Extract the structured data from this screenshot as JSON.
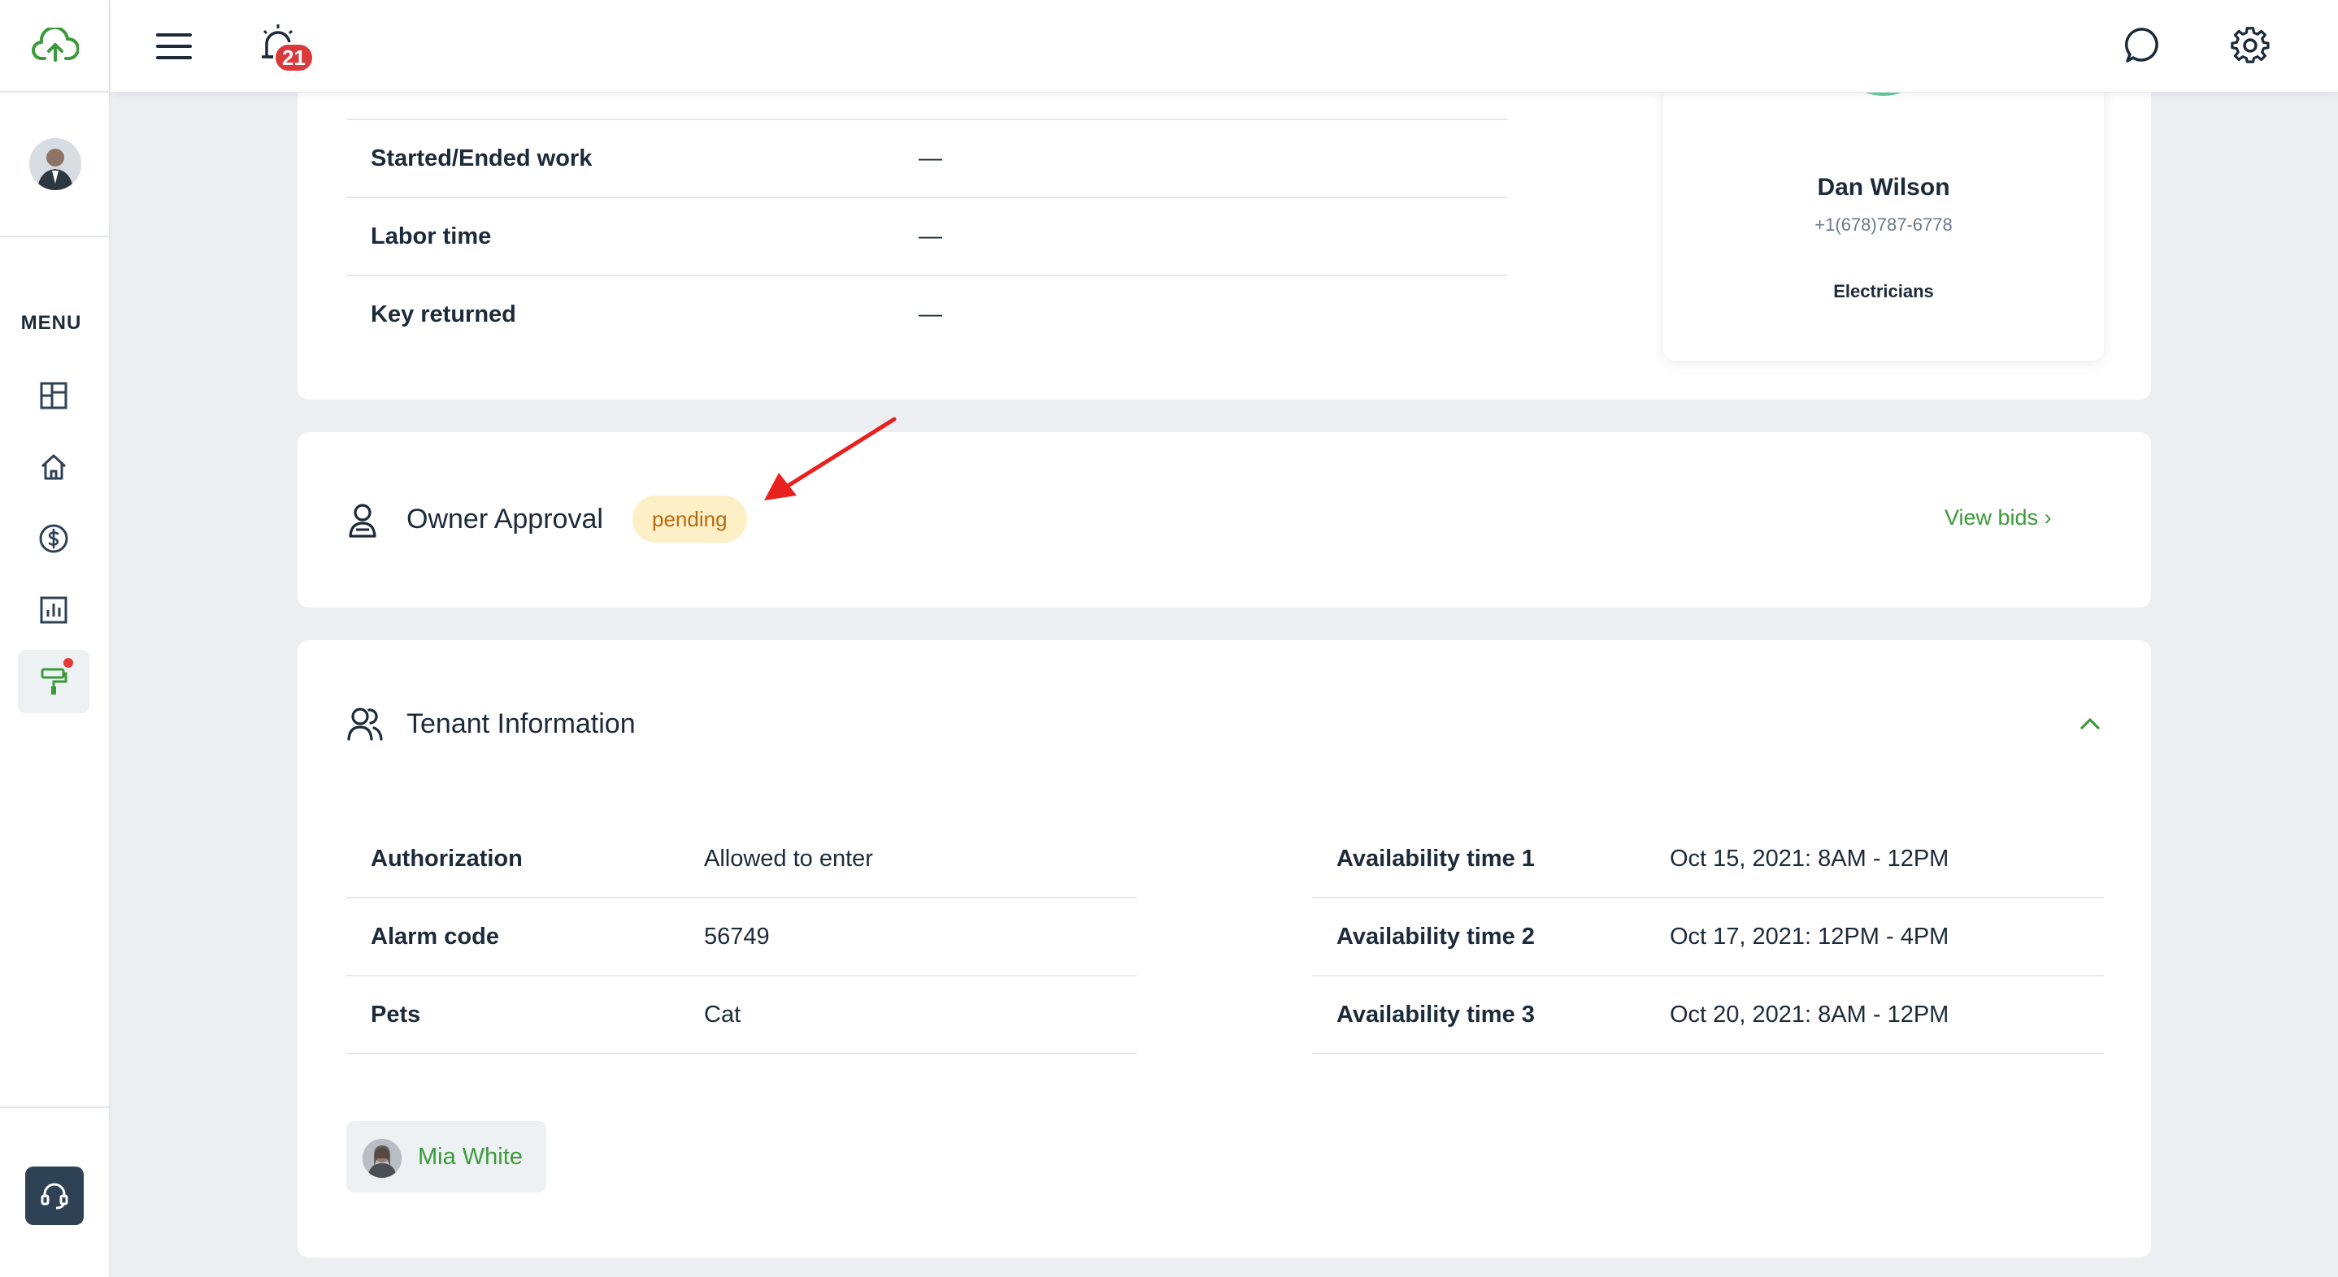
{
  "topbar": {
    "notification_count": "21"
  },
  "sidebar": {
    "menu_label": "MENU",
    "items": [
      {
        "icon": "dashboard-icon"
      },
      {
        "icon": "home-icon"
      },
      {
        "icon": "dollar-icon"
      },
      {
        "icon": "chart-icon"
      },
      {
        "icon": "paint-roller-icon",
        "active": true,
        "has_dot": true
      }
    ]
  },
  "work_details": {
    "rows": [
      {
        "label": "Started/Ended work",
        "value": "—"
      },
      {
        "label": "Labor time",
        "value": "—"
      },
      {
        "label": "Key returned",
        "value": "—"
      }
    ]
  },
  "assignee": {
    "name": "Dan Wilson",
    "phone": "+1(678)787-6778",
    "role": "Electricians",
    "avatar_color": "#5fcda0"
  },
  "owner_approval": {
    "title": "Owner Approval",
    "status": "pending",
    "view_bids": "View bids ›"
  },
  "tenant": {
    "title": "Tenant Information",
    "left_rows": [
      {
        "label": "Authorization",
        "value": "Allowed to enter"
      },
      {
        "label": "Alarm code",
        "value": "56749"
      },
      {
        "label": "Pets",
        "value": "Cat"
      }
    ],
    "right_rows": [
      {
        "label": "Availability time 1",
        "value": "Oct 15, 2021: 8AM - 12PM"
      },
      {
        "label": "Availability time 2",
        "value": "Oct 17, 2021: 12PM - 4PM"
      },
      {
        "label": "Availability time 3",
        "value": "Oct 20, 2021: 8AM - 12PM"
      }
    ],
    "contact_name": "Mia White"
  },
  "colors": {
    "accent_green": "#3c9a3a",
    "badge_red": "#d9393b",
    "pending_bg": "#fdf0c6",
    "pending_text": "#b86a12",
    "annotation_arrow": "#e8201e"
  }
}
